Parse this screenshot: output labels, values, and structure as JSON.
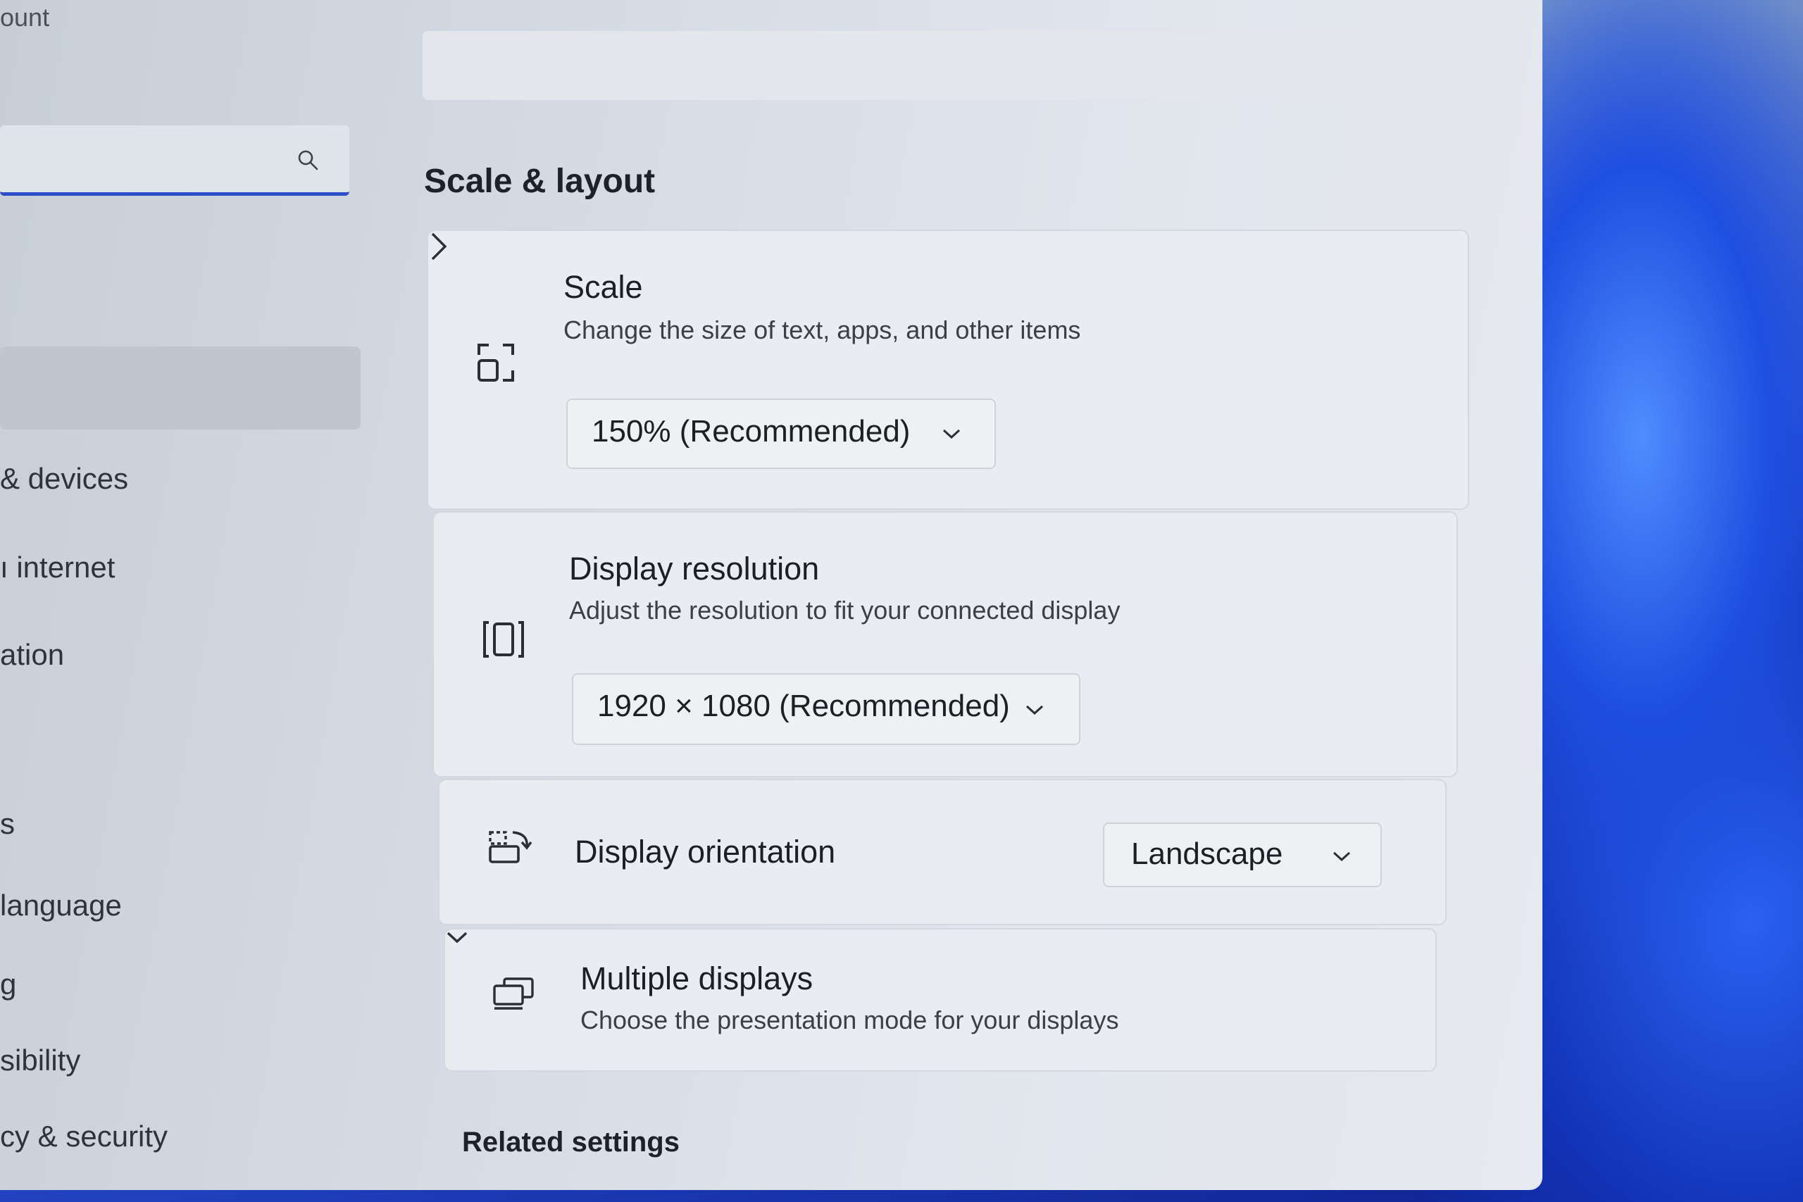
{
  "sidebar": {
    "account_partial": "ount",
    "search_placeholder": "",
    "items": [
      {
        "label": "& devices"
      },
      {
        "label": "ı internet"
      },
      {
        "label": "ation"
      },
      {
        "label": "s"
      },
      {
        "label": "language"
      },
      {
        "label": "g"
      },
      {
        "label": "sibility"
      },
      {
        "label": "cy & security"
      }
    ]
  },
  "main": {
    "section_title": "Scale & layout",
    "scale": {
      "title": "Scale",
      "subtitle": "Change the size of text, apps, and other items",
      "value": "150% (Recommended)",
      "icon": "scale-icon"
    },
    "resolution": {
      "title": "Display resolution",
      "subtitle": "Adjust the resolution to fit your connected display",
      "value": "1920 × 1080 (Recommended)",
      "icon": "resolution-icon"
    },
    "orientation": {
      "title": "Display orientation",
      "value": "Landscape",
      "icon": "orientation-icon"
    },
    "multiple": {
      "title": "Multiple displays",
      "subtitle": "Choose the presentation mode for your displays",
      "icon": "multiple-displays-icon"
    },
    "related_title": "Related settings"
  },
  "colors": {
    "accent": "#2b4fc8",
    "card": "#e9ecf1",
    "text": "#1c1f24"
  }
}
